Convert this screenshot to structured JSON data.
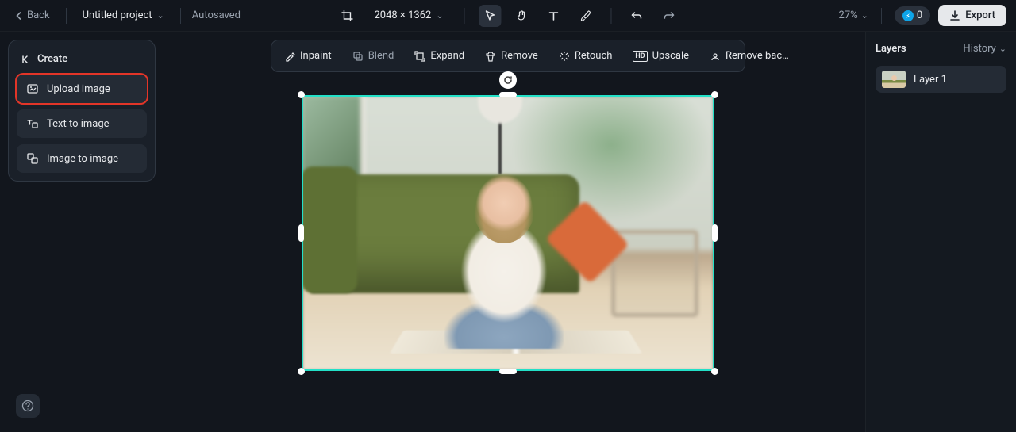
{
  "header": {
    "back_label": "Back",
    "project_name": "Untitled project",
    "autosave_label": "Autosaved",
    "canvas_dimensions": "2048 × 1362",
    "zoom_label": "27%",
    "credits_value": "0",
    "export_label": "Export"
  },
  "sidebar": {
    "create_label": "Create",
    "items": [
      {
        "label": "Upload image"
      },
      {
        "label": "Text to image"
      },
      {
        "label": "Image to image"
      }
    ]
  },
  "context_toolbar": {
    "items": [
      {
        "label": "Inpaint"
      },
      {
        "label": "Blend"
      },
      {
        "label": "Expand"
      },
      {
        "label": "Remove"
      },
      {
        "label": "Retouch"
      },
      {
        "label": "Upscale"
      },
      {
        "label": "Remove back…"
      }
    ]
  },
  "right_panel": {
    "title": "Layers",
    "history_label": "History",
    "layers": [
      {
        "name": "Layer 1"
      }
    ]
  }
}
